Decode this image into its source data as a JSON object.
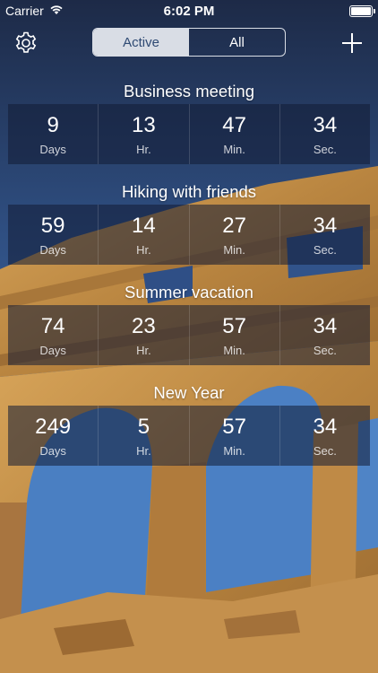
{
  "status_bar": {
    "carrier": "Carrier",
    "time": "6:02 PM"
  },
  "nav": {
    "segments": [
      "Active",
      "All"
    ],
    "selected_segment": "Active",
    "settings_icon": "gear-icon",
    "add_icon": "plus-icon"
  },
  "units": {
    "days": "Days",
    "hours": "Hr.",
    "minutes": "Min.",
    "seconds": "Sec."
  },
  "events": [
    {
      "title": "Business meeting",
      "days": "9",
      "hours": "13",
      "minutes": "47",
      "seconds": "34"
    },
    {
      "title": "Hiking with friends",
      "days": "59",
      "hours": "14",
      "minutes": "27",
      "seconds": "34"
    },
    {
      "title": "Summer vacation",
      "days": "74",
      "hours": "23",
      "minutes": "57",
      "seconds": "34"
    },
    {
      "title": "New Year",
      "days": "249",
      "hours": "5",
      "minutes": "57",
      "seconds": "34"
    }
  ],
  "colors": {
    "sky_top": "#1d2d4d",
    "sky_bottom": "#3f6fb0",
    "stone": "#c9974f",
    "overlay": "#121c34"
  }
}
